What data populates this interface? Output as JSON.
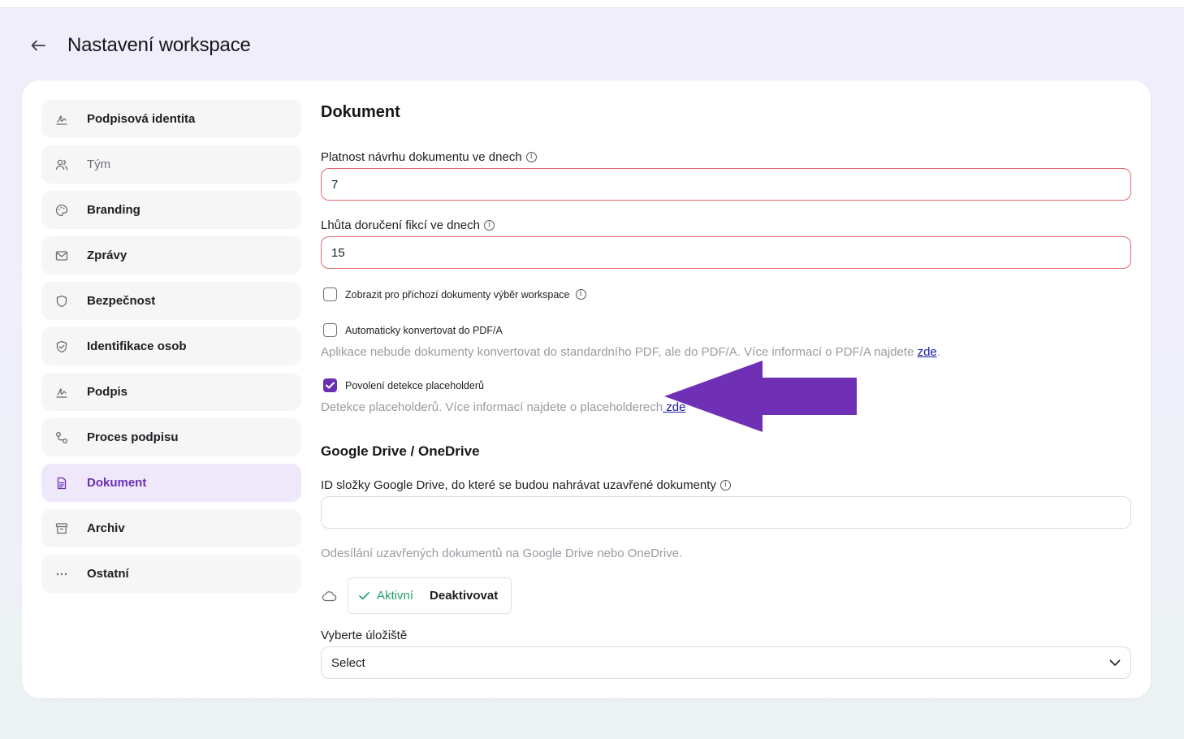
{
  "header": {
    "title": "Nastavení workspace",
    "back_icon": "arrow-left-icon"
  },
  "sidebar": {
    "items": [
      {
        "label": "Podpisová identita",
        "icon": "signature-icon",
        "active": false,
        "muted": false
      },
      {
        "label": "Tým",
        "icon": "users-icon",
        "active": false,
        "muted": true
      },
      {
        "label": "Branding",
        "icon": "palette-icon",
        "active": false,
        "muted": false
      },
      {
        "label": "Zprávy",
        "icon": "mail-icon",
        "active": false,
        "muted": false
      },
      {
        "label": "Bezpečnost",
        "icon": "shield-icon",
        "active": false,
        "muted": false
      },
      {
        "label": "Identifikace osob",
        "icon": "shield-check-icon",
        "active": false,
        "muted": false
      },
      {
        "label": "Podpis",
        "icon": "signature-icon",
        "active": false,
        "muted": false
      },
      {
        "label": "Proces podpisu",
        "icon": "workflow-icon",
        "active": false,
        "muted": false
      },
      {
        "label": "Dokument",
        "icon": "document-icon",
        "active": true,
        "muted": false
      },
      {
        "label": "Archiv",
        "icon": "archive-icon",
        "active": false,
        "muted": false
      },
      {
        "label": "Ostatní",
        "icon": "more-dots-icon",
        "active": false,
        "muted": false
      }
    ]
  },
  "document": {
    "title": "Dokument",
    "validity_label": "Platnost návrhu dokumentu ve dnech",
    "validity_value": "7",
    "delivery_label": "Lhůta doručení fikcí ve dnech",
    "delivery_value": "15",
    "show_workspace_label": "Zobrazit pro příchozí dokumenty výběr workspace",
    "show_workspace_checked": false,
    "convert_pdfa_label": "Automaticky konvertovat do PDF/A",
    "convert_pdfa_checked": false,
    "convert_pdfa_hint": "Aplikace nebude dokumenty konvertovat do standardního PDF, ale do PDF/A. Více informací o PDF/A najdete ",
    "convert_pdfa_link": "zde",
    "convert_pdfa_hint_end": ".",
    "placeholder_label": "Povolení detekce placeholderů",
    "placeholder_checked": true,
    "placeholder_hint": "Detekce placeholderů. Více informací najdete o placeholderech",
    "placeholder_link": " zde"
  },
  "cloud": {
    "title": "Google Drive / OneDrive",
    "folder_label": "ID složky Google Drive, do které se budou nahrávat uzavřené dokumenty",
    "folder_value": "",
    "hint": "Odesílání uzavřených dokumentů na Google Drive nebo OneDrive.",
    "cloud_icon": "cloud-icon",
    "active_label": "Aktivní",
    "deactivate_label": "Deaktivovat",
    "storage_label": "Vyberte úložiště",
    "storage_value": "Select"
  },
  "colors": {
    "accent": "#6b2fb3",
    "arrow": "#6f30b5",
    "active_green": "#22a06b",
    "error_border": "#e06a72"
  }
}
